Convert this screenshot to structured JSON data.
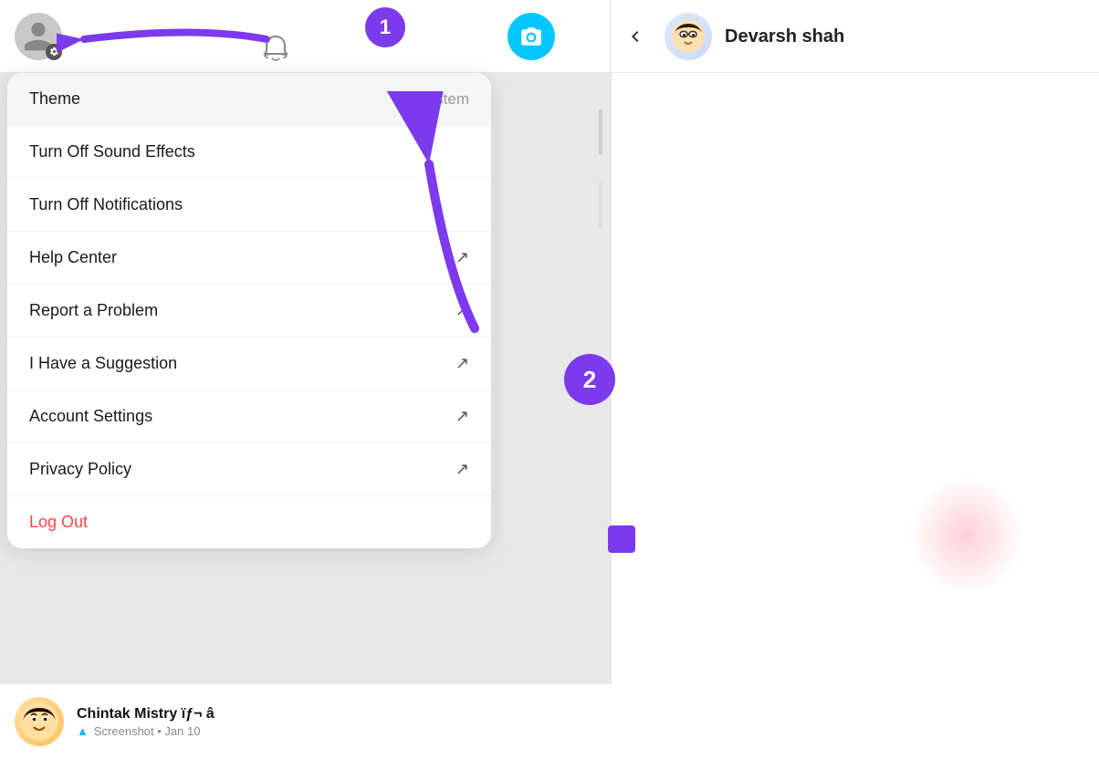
{
  "header": {
    "user_name": "Devarsh shah",
    "back_label": "<"
  },
  "annotations": {
    "badge_1": "1",
    "badge_2": "2"
  },
  "menu": {
    "items": [
      {
        "id": "theme",
        "label": "Theme",
        "value": "System",
        "external": false,
        "special": "theme"
      },
      {
        "id": "sound",
        "label": "Turn Off Sound Effects",
        "value": "",
        "external": false
      },
      {
        "id": "notifications",
        "label": "Turn Off Notifications",
        "value": "",
        "external": false
      },
      {
        "id": "help",
        "label": "Help Center",
        "value": "",
        "external": true
      },
      {
        "id": "report",
        "label": "Report a Problem",
        "value": "",
        "external": true
      },
      {
        "id": "suggestion",
        "label": "I Have a Suggestion",
        "value": "",
        "external": true
      },
      {
        "id": "account",
        "label": "Account Settings",
        "value": "",
        "external": true
      },
      {
        "id": "privacy",
        "label": "Privacy Policy",
        "value": "",
        "external": true
      },
      {
        "id": "logout",
        "label": "Log Out",
        "value": "",
        "external": false,
        "special": "logout"
      }
    ]
  },
  "bottom_contact": {
    "name": "Chintak Mistry ïƒ¬ â",
    "meta_icon": "snapchat",
    "meta_text": "Screenshot • Jan 10"
  }
}
